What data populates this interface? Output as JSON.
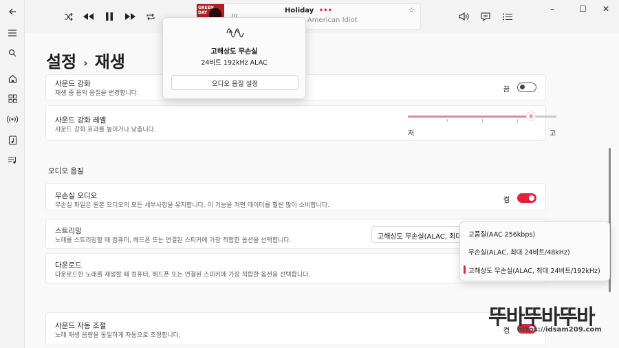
{
  "window": {
    "minimize_label": "–",
    "maximize_label": "☐",
    "close_label": "✕"
  },
  "sidebar": {
    "icons": [
      "back-icon",
      "menu-icon",
      "search-icon",
      "home-icon",
      "browse-icon",
      "radio-icon",
      "library-icon",
      "playlist-icon"
    ]
  },
  "player": {
    "album_art_text": "GREEN DAY",
    "title": "Holiday",
    "more": "•••",
    "subtitle": "Green Day — American Idiot",
    "star": "☆"
  },
  "header": {
    "breadcrumb_root": "설정",
    "breadcrumb_sep": "›",
    "breadcrumb_current": "재생"
  },
  "rows": {
    "sound_enhance": {
      "title": "사운드 강화",
      "desc": "재생 중 음악 음질을 변경합니다.",
      "toggle_label": "끔",
      "toggle_state": "off"
    },
    "sound_level": {
      "title": "사운드 강화 레벨",
      "desc": "사운드 강화 효과를 높이거나 낮춥니다.",
      "low_label": "저",
      "high_label": "고",
      "value": 0.83
    },
    "audio_quality_section": "오디오 음질",
    "lossless": {
      "title": "무손실 오디오",
      "desc": "무손실 파일은 원본 오디오의 모든 세부사항을 유지합니다. 이 기능을 켜면 데이터를 훨씬 많이 소비합니다.",
      "toggle_label": "켬",
      "toggle_state": "on"
    },
    "streaming": {
      "title": "스트리밍",
      "desc": "노래를 스트리밍할 때 컴퓨터, 헤드폰 또는 연결된 스피커에 가장 적합한 옵션을 선택합니다.",
      "select_value": "고해상도 무손실(ALAC, 최대"
    },
    "download": {
      "title": "다운로드",
      "desc": "다운로드한 노래를 재생할 때 컴퓨터, 헤드폰 또는 연결된 스피커에 가장 적합한 옵션을 선택합니다."
    },
    "auto_volume": {
      "title": "사운드 자동 조절",
      "desc": "노래 재생 음량을 동일하게 자동으로 조정합니다.",
      "toggle_label": "켬",
      "toggle_state": "on"
    }
  },
  "dropdown": {
    "options": [
      "고품질(AAC 256kbps)",
      "무손실(ALAC, 최대 24비트/48kHz)",
      "고해상도 무손실(ALAC, 최대 24비트/192kHz)"
    ],
    "selected_index": 2
  },
  "quality_popup": {
    "title": "고해상도 무손실",
    "sub": "24비트 192kHz ALAC",
    "button": "오디오 음질 설정"
  },
  "watermark": {
    "text": "뚜바뚜바뚜바",
    "url": "https://idsam209.com"
  },
  "colors": {
    "accent": "#e0243d",
    "slider_fill": "#d98b95"
  }
}
